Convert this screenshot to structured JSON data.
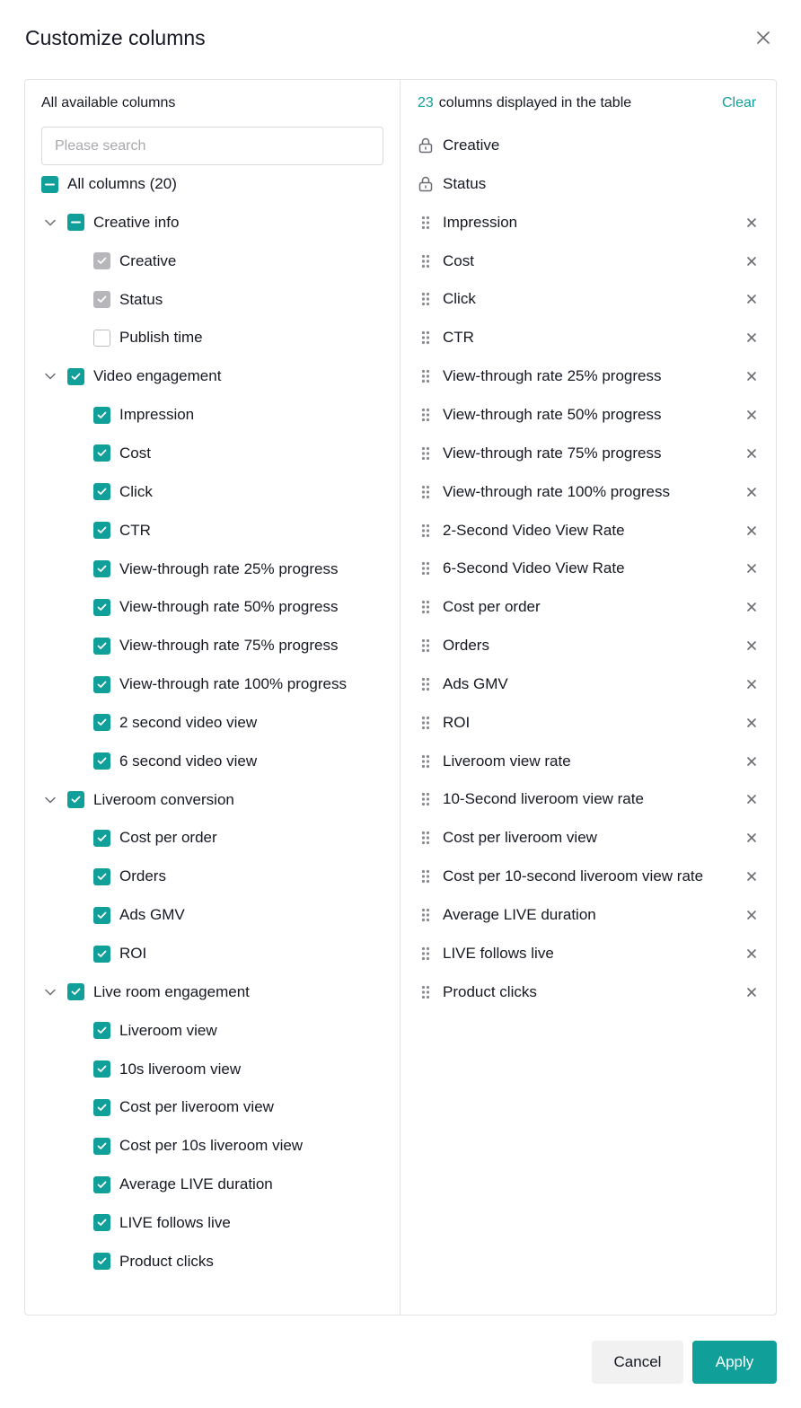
{
  "dialog": {
    "title": "Customize columns"
  },
  "left": {
    "heading": "All available columns",
    "search_placeholder": "Please search",
    "all_label": "All columns (20)",
    "groups": [
      {
        "label": "Creative info",
        "state": "indeterminate",
        "items": [
          {
            "label": "Creative",
            "state": "disabled-checked"
          },
          {
            "label": "Status",
            "state": "disabled-checked"
          },
          {
            "label": "Publish time",
            "state": "unchecked"
          }
        ]
      },
      {
        "label": "Video engagement",
        "state": "checked",
        "items": [
          {
            "label": "Impression",
            "state": "checked"
          },
          {
            "label": "Cost",
            "state": "checked"
          },
          {
            "label": "Click",
            "state": "checked"
          },
          {
            "label": "CTR",
            "state": "checked"
          },
          {
            "label": "View-through rate 25% progress",
            "state": "checked"
          },
          {
            "label": "View-through rate 50% progress",
            "state": "checked"
          },
          {
            "label": "View-through rate 75% progress",
            "state": "checked"
          },
          {
            "label": "View-through rate 100% progress",
            "state": "checked"
          },
          {
            "label": "2 second video view",
            "state": "checked"
          },
          {
            "label": "6 second video view",
            "state": "checked"
          }
        ]
      },
      {
        "label": "Liveroom conversion",
        "state": "checked",
        "items": [
          {
            "label": "Cost per order",
            "state": "checked"
          },
          {
            "label": "Orders",
            "state": "checked"
          },
          {
            "label": "Ads GMV",
            "state": "checked"
          },
          {
            "label": "ROI",
            "state": "checked"
          }
        ]
      },
      {
        "label": "Live room engagement",
        "state": "checked",
        "items": [
          {
            "label": "Liveroom view",
            "state": "checked"
          },
          {
            "label": "10s liveroom view",
            "state": "checked"
          },
          {
            "label": "Cost per liveroom view",
            "state": "checked"
          },
          {
            "label": "Cost per 10s liveroom view",
            "state": "checked"
          },
          {
            "label": "Average LIVE duration",
            "state": "checked"
          },
          {
            "label": "LIVE follows live",
            "state": "checked"
          },
          {
            "label": "Product clicks",
            "state": "checked"
          }
        ]
      }
    ]
  },
  "right": {
    "count": "23",
    "heading_suffix": "columns displayed in the table",
    "clear_label": "Clear",
    "locked": [
      "Creative",
      "Status"
    ],
    "selected": [
      "Impression",
      "Cost",
      "Click",
      "CTR",
      "View-through rate 25% progress",
      "View-through rate 50% progress",
      "View-through rate 75% progress",
      "View-through rate 100% progress",
      "2-Second Video View Rate",
      "6-Second Video View Rate",
      "Cost per order",
      "Orders",
      "Ads GMV",
      "ROI",
      "Liveroom view rate",
      "10-Second liveroom view rate",
      "Cost per liveroom view",
      "Cost per 10-second liveroom view rate",
      "Average LIVE duration",
      "LIVE follows live",
      "Product clicks"
    ]
  },
  "footer": {
    "cancel_label": "Cancel",
    "apply_label": "Apply"
  },
  "colors": {
    "accent": "#119f99",
    "disabled_check": "#b7b7bb",
    "border": "#e3e3e5"
  }
}
